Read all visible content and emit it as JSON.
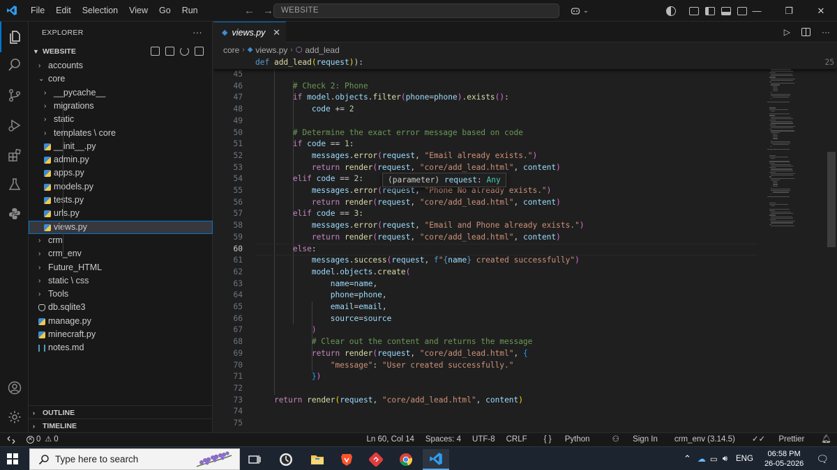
{
  "titlebar": {
    "menu": [
      "File",
      "Edit",
      "Selection",
      "View",
      "Go",
      "Run"
    ],
    "command_center": "WEBSITE"
  },
  "explorer": {
    "header": "EXPLORER",
    "workspace": "WEBSITE",
    "tree": [
      {
        "label": "accounts",
        "kind": "folder",
        "depth": 0,
        "expanded": false
      },
      {
        "label": "core",
        "kind": "folder",
        "depth": 0,
        "expanded": true
      },
      {
        "label": "__pycache__",
        "kind": "folder",
        "depth": 1,
        "expanded": false
      },
      {
        "label": "migrations",
        "kind": "folder",
        "depth": 1,
        "expanded": false
      },
      {
        "label": "static",
        "kind": "folder",
        "depth": 1,
        "expanded": false
      },
      {
        "label": "templates \\ core",
        "kind": "folder",
        "depth": 1,
        "expanded": false
      },
      {
        "label": "__init__.py",
        "kind": "python",
        "depth": 1
      },
      {
        "label": "admin.py",
        "kind": "python",
        "depth": 1
      },
      {
        "label": "apps.py",
        "kind": "python",
        "depth": 1
      },
      {
        "label": "models.py",
        "kind": "python",
        "depth": 1
      },
      {
        "label": "tests.py",
        "kind": "python",
        "depth": 1
      },
      {
        "label": "urls.py",
        "kind": "python",
        "depth": 1
      },
      {
        "label": "views.py",
        "kind": "python",
        "depth": 1,
        "selected": true
      },
      {
        "label": "crm",
        "kind": "folder",
        "depth": 0,
        "expanded": false
      },
      {
        "label": "crm_env",
        "kind": "folder",
        "depth": 0,
        "expanded": false
      },
      {
        "label": "Future_HTML",
        "kind": "folder",
        "depth": 0,
        "expanded": false
      },
      {
        "label": "static \\ css",
        "kind": "folder",
        "depth": 0,
        "expanded": false
      },
      {
        "label": "Tools",
        "kind": "folder",
        "depth": 0,
        "expanded": false
      },
      {
        "label": "db.sqlite3",
        "kind": "db",
        "depth": 0
      },
      {
        "label": "manage.py",
        "kind": "python",
        "depth": 0
      },
      {
        "label": "minecraft.py",
        "kind": "python",
        "depth": 0
      },
      {
        "label": "notes.md",
        "kind": "markdown",
        "depth": 0
      }
    ],
    "outline_label": "OUTLINE",
    "timeline_label": "TIMELINE"
  },
  "editor": {
    "tab": "views.py",
    "breadcrumb": [
      "core",
      "views.py",
      "add_lead"
    ],
    "sticky": {
      "line": "25",
      "tokens": [
        [
          "kd",
          "def "
        ],
        [
          "fn",
          "add_lead"
        ],
        [
          "bk",
          "("
        ],
        [
          "pa",
          "request"
        ],
        [
          "bk",
          ")"
        ],
        [
          "",
          "):"
        ]
      ]
    },
    "active_line": "60",
    "hover": {
      "prefix": "(parameter) ",
      "name": "request",
      "sep": ": ",
      "type": "Any"
    },
    "lines": [
      {
        "n": "45",
        "t": []
      },
      {
        "n": "46",
        "t": [
          [
            "",
            "        "
          ],
          [
            "cm",
            "# Check 2: Phone"
          ]
        ]
      },
      {
        "n": "47",
        "t": [
          [
            "",
            "        "
          ],
          [
            "kw",
            "if "
          ],
          [
            "pa",
            "model"
          ],
          [
            "",
            "."
          ],
          [
            "pa",
            "objects"
          ],
          [
            "",
            "."
          ],
          [
            "fn",
            "filter"
          ],
          [
            "bk2",
            "("
          ],
          [
            "pa",
            "phone"
          ],
          [
            "",
            "="
          ],
          [
            "pa",
            "phone"
          ],
          [
            "bk2",
            ")"
          ],
          [
            "",
            "."
          ],
          [
            "fn",
            "exists"
          ],
          [
            "bk2",
            "()"
          ],
          [
            "",
            ":"
          ]
        ]
      },
      {
        "n": "48",
        "t": [
          [
            "",
            "            "
          ],
          [
            "pa",
            "code"
          ],
          [
            "",
            " += "
          ],
          [
            "nu",
            "2"
          ]
        ]
      },
      {
        "n": "49",
        "t": []
      },
      {
        "n": "50",
        "t": [
          [
            "",
            "        "
          ],
          [
            "cm",
            "# Determine the exact error message based on code"
          ]
        ]
      },
      {
        "n": "51",
        "t": [
          [
            "",
            "        "
          ],
          [
            "kw",
            "if "
          ],
          [
            "pa",
            "code"
          ],
          [
            "",
            " == "
          ],
          [
            "nu",
            "1"
          ],
          [
            "",
            ":"
          ]
        ]
      },
      {
        "n": "52",
        "t": [
          [
            "",
            "            "
          ],
          [
            "pa",
            "messages"
          ],
          [
            "",
            "."
          ],
          [
            "fn",
            "error"
          ],
          [
            "bk2",
            "("
          ],
          [
            "pa",
            "request"
          ],
          [
            "",
            ", "
          ],
          [
            "st",
            "\"Email already exists.\""
          ],
          [
            "bk2",
            ")"
          ]
        ]
      },
      {
        "n": "53",
        "t": [
          [
            "",
            "            "
          ],
          [
            "kw",
            "return "
          ],
          [
            "fn",
            "render"
          ],
          [
            "bk2",
            "("
          ],
          [
            "pa",
            "request"
          ],
          [
            "",
            ", "
          ],
          [
            "st",
            "\"core/add_lead.html\""
          ],
          [
            "",
            ", "
          ],
          [
            "pa",
            "content"
          ],
          [
            "bk2",
            ")"
          ]
        ]
      },
      {
        "n": "54",
        "t": [
          [
            "",
            "        "
          ],
          [
            "kw",
            "elif "
          ],
          [
            "pa",
            "code"
          ],
          [
            "",
            " == "
          ],
          [
            "nu",
            "2"
          ],
          [
            "",
            ":"
          ]
        ]
      },
      {
        "n": "55",
        "t": [
          [
            "",
            "            "
          ],
          [
            "pa",
            "messages"
          ],
          [
            "",
            "."
          ],
          [
            "fn",
            "error"
          ],
          [
            "bk2",
            "("
          ],
          [
            "pa",
            "request"
          ],
          [
            "",
            ", "
          ],
          [
            "st",
            "\"Phone No already exists.\""
          ],
          [
            "bk2",
            ")"
          ]
        ]
      },
      {
        "n": "56",
        "t": [
          [
            "",
            "            "
          ],
          [
            "kw",
            "return "
          ],
          [
            "fn",
            "render"
          ],
          [
            "bk2",
            "("
          ],
          [
            "pa",
            "request"
          ],
          [
            "",
            ", "
          ],
          [
            "st",
            "\"core/add_lead.html\""
          ],
          [
            "",
            ", "
          ],
          [
            "pa",
            "content"
          ],
          [
            "bk2",
            ")"
          ]
        ]
      },
      {
        "n": "57",
        "t": [
          [
            "",
            "        "
          ],
          [
            "kw",
            "elif "
          ],
          [
            "pa",
            "code"
          ],
          [
            "",
            " == "
          ],
          [
            "nu",
            "3"
          ],
          [
            "",
            ":"
          ]
        ]
      },
      {
        "n": "58",
        "t": [
          [
            "",
            "            "
          ],
          [
            "pa",
            "messages"
          ],
          [
            "",
            "."
          ],
          [
            "fn",
            "error"
          ],
          [
            "bk2",
            "("
          ],
          [
            "pa",
            "request"
          ],
          [
            "",
            ", "
          ],
          [
            "st",
            "\"Email and Phone already exists.\""
          ],
          [
            "bk2",
            ")"
          ]
        ]
      },
      {
        "n": "59",
        "t": [
          [
            "",
            "            "
          ],
          [
            "kw",
            "return "
          ],
          [
            "fn",
            "render"
          ],
          [
            "bk2",
            "("
          ],
          [
            "pa",
            "request"
          ],
          [
            "",
            ", "
          ],
          [
            "st",
            "\"core/add_lead.html\""
          ],
          [
            "",
            ", "
          ],
          [
            "pa",
            "content"
          ],
          [
            "bk2",
            ")"
          ]
        ]
      },
      {
        "n": "60",
        "t": [
          [
            "",
            "        "
          ],
          [
            "kw",
            "else"
          ],
          [
            "",
            ":"
          ]
        ]
      },
      {
        "n": "61",
        "t": [
          [
            "",
            "            "
          ],
          [
            "pa",
            "messages"
          ],
          [
            "",
            "."
          ],
          [
            "fn",
            "success"
          ],
          [
            "bk2",
            "("
          ],
          [
            "pa",
            "request"
          ],
          [
            "",
            ", "
          ],
          [
            "kd",
            "f"
          ],
          [
            "st",
            "\""
          ],
          [
            "kd",
            "{"
          ],
          [
            "pa",
            "name"
          ],
          [
            "kd",
            "}"
          ],
          [
            "st",
            " created successfully\""
          ],
          [
            "bk2",
            ")"
          ]
        ]
      },
      {
        "n": "62",
        "t": [
          [
            "",
            "            "
          ],
          [
            "pa",
            "model"
          ],
          [
            "",
            "."
          ],
          [
            "pa",
            "objects"
          ],
          [
            "",
            "."
          ],
          [
            "fn",
            "create"
          ],
          [
            "bk2",
            "("
          ]
        ]
      },
      {
        "n": "63",
        "t": [
          [
            "",
            "                "
          ],
          [
            "pa",
            "name"
          ],
          [
            "",
            "="
          ],
          [
            "pa",
            "name"
          ],
          [
            "",
            ","
          ]
        ]
      },
      {
        "n": "64",
        "t": [
          [
            "",
            "                "
          ],
          [
            "pa",
            "phone"
          ],
          [
            "",
            "="
          ],
          [
            "pa",
            "phone"
          ],
          [
            "",
            ","
          ]
        ]
      },
      {
        "n": "65",
        "t": [
          [
            "",
            "                "
          ],
          [
            "pa",
            "email"
          ],
          [
            "",
            "="
          ],
          [
            "pa",
            "email"
          ],
          [
            "",
            ","
          ]
        ]
      },
      {
        "n": "66",
        "t": [
          [
            "",
            "                "
          ],
          [
            "pa",
            "source"
          ],
          [
            "",
            "="
          ],
          [
            "pa",
            "source"
          ]
        ]
      },
      {
        "n": "67",
        "t": [
          [
            "",
            "            "
          ],
          [
            "bk2",
            ")"
          ]
        ]
      },
      {
        "n": "68",
        "t": [
          [
            "",
            "            "
          ],
          [
            "cm",
            "# Clear out the content and returns the message"
          ]
        ]
      },
      {
        "n": "69",
        "t": [
          [
            "",
            "            "
          ],
          [
            "kw",
            "return "
          ],
          [
            "fn",
            "render"
          ],
          [
            "bk2",
            "("
          ],
          [
            "pa",
            "request"
          ],
          [
            "",
            ", "
          ],
          [
            "st",
            "\"core/add_lead.html\""
          ],
          [
            "",
            ", "
          ],
          [
            "bk3",
            "{"
          ]
        ]
      },
      {
        "n": "70",
        "t": [
          [
            "",
            "                "
          ],
          [
            "st",
            "\"message\""
          ],
          [
            "",
            ": "
          ],
          [
            "st",
            "\"User created successfully.\""
          ]
        ]
      },
      {
        "n": "71",
        "t": [
          [
            "",
            "            "
          ],
          [
            "bk3",
            "}"
          ],
          [
            "bk2",
            ")"
          ]
        ]
      },
      {
        "n": "72",
        "t": []
      },
      {
        "n": "73",
        "t": [
          [
            "",
            "    "
          ],
          [
            "kw",
            "return "
          ],
          [
            "fn",
            "render"
          ],
          [
            "bk",
            "("
          ],
          [
            "pa",
            "request"
          ],
          [
            "",
            ", "
          ],
          [
            "st",
            "\"core/add_lead.html\""
          ],
          [
            "",
            ", "
          ],
          [
            "pa",
            "content"
          ],
          [
            "bk",
            ")"
          ]
        ]
      },
      {
        "n": "74",
        "t": []
      },
      {
        "n": "75",
        "t": []
      }
    ]
  },
  "statusbar": {
    "problems": "0",
    "warnings": "0",
    "position": "Ln 60, Col 14",
    "spaces": "Spaces: 4",
    "encoding": "UTF-8",
    "eol": "CRLF",
    "language_braces": "{ }",
    "language": "Python",
    "sign_in": "Sign In",
    "interpreter": "crm_env (3.14.5)",
    "formatter": "Prettier"
  },
  "taskbar": {
    "search_placeholder": "Type here to search",
    "language": "ENG",
    "time": "06:58 PM",
    "date": "26-05-2026"
  },
  "colors": {
    "accent": "#0078d4",
    "editor_bg": "#1f1f1f",
    "chrome_bg": "#181818"
  }
}
